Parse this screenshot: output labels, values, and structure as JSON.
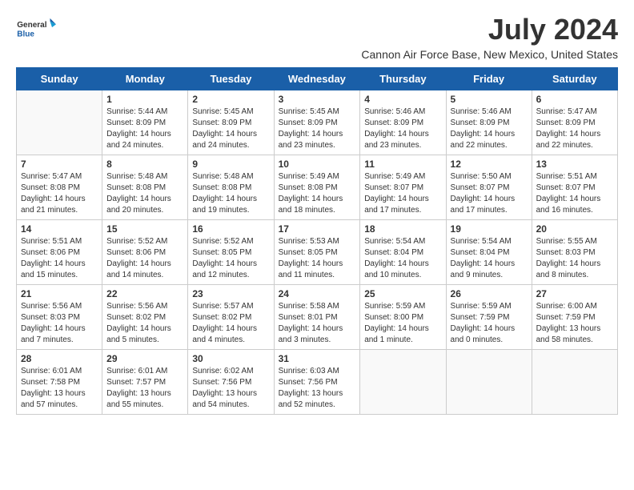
{
  "header": {
    "logo_general": "General",
    "logo_blue": "Blue",
    "month": "July 2024",
    "location": "Cannon Air Force Base, New Mexico, United States"
  },
  "weekdays": [
    "Sunday",
    "Monday",
    "Tuesday",
    "Wednesday",
    "Thursday",
    "Friday",
    "Saturday"
  ],
  "weeks": [
    [
      {
        "day": "",
        "info": ""
      },
      {
        "day": "1",
        "info": "Sunrise: 5:44 AM\nSunset: 8:09 PM\nDaylight: 14 hours\nand 24 minutes."
      },
      {
        "day": "2",
        "info": "Sunrise: 5:45 AM\nSunset: 8:09 PM\nDaylight: 14 hours\nand 24 minutes."
      },
      {
        "day": "3",
        "info": "Sunrise: 5:45 AM\nSunset: 8:09 PM\nDaylight: 14 hours\nand 23 minutes."
      },
      {
        "day": "4",
        "info": "Sunrise: 5:46 AM\nSunset: 8:09 PM\nDaylight: 14 hours\nand 23 minutes."
      },
      {
        "day": "5",
        "info": "Sunrise: 5:46 AM\nSunset: 8:09 PM\nDaylight: 14 hours\nand 22 minutes."
      },
      {
        "day": "6",
        "info": "Sunrise: 5:47 AM\nSunset: 8:09 PM\nDaylight: 14 hours\nand 22 minutes."
      }
    ],
    [
      {
        "day": "7",
        "info": "Sunrise: 5:47 AM\nSunset: 8:08 PM\nDaylight: 14 hours\nand 21 minutes."
      },
      {
        "day": "8",
        "info": "Sunrise: 5:48 AM\nSunset: 8:08 PM\nDaylight: 14 hours\nand 20 minutes."
      },
      {
        "day": "9",
        "info": "Sunrise: 5:48 AM\nSunset: 8:08 PM\nDaylight: 14 hours\nand 19 minutes."
      },
      {
        "day": "10",
        "info": "Sunrise: 5:49 AM\nSunset: 8:08 PM\nDaylight: 14 hours\nand 18 minutes."
      },
      {
        "day": "11",
        "info": "Sunrise: 5:49 AM\nSunset: 8:07 PM\nDaylight: 14 hours\nand 17 minutes."
      },
      {
        "day": "12",
        "info": "Sunrise: 5:50 AM\nSunset: 8:07 PM\nDaylight: 14 hours\nand 17 minutes."
      },
      {
        "day": "13",
        "info": "Sunrise: 5:51 AM\nSunset: 8:07 PM\nDaylight: 14 hours\nand 16 minutes."
      }
    ],
    [
      {
        "day": "14",
        "info": "Sunrise: 5:51 AM\nSunset: 8:06 PM\nDaylight: 14 hours\nand 15 minutes."
      },
      {
        "day": "15",
        "info": "Sunrise: 5:52 AM\nSunset: 8:06 PM\nDaylight: 14 hours\nand 14 minutes."
      },
      {
        "day": "16",
        "info": "Sunrise: 5:52 AM\nSunset: 8:05 PM\nDaylight: 14 hours\nand 12 minutes."
      },
      {
        "day": "17",
        "info": "Sunrise: 5:53 AM\nSunset: 8:05 PM\nDaylight: 14 hours\nand 11 minutes."
      },
      {
        "day": "18",
        "info": "Sunrise: 5:54 AM\nSunset: 8:04 PM\nDaylight: 14 hours\nand 10 minutes."
      },
      {
        "day": "19",
        "info": "Sunrise: 5:54 AM\nSunset: 8:04 PM\nDaylight: 14 hours\nand 9 minutes."
      },
      {
        "day": "20",
        "info": "Sunrise: 5:55 AM\nSunset: 8:03 PM\nDaylight: 14 hours\nand 8 minutes."
      }
    ],
    [
      {
        "day": "21",
        "info": "Sunrise: 5:56 AM\nSunset: 8:03 PM\nDaylight: 14 hours\nand 7 minutes."
      },
      {
        "day": "22",
        "info": "Sunrise: 5:56 AM\nSunset: 8:02 PM\nDaylight: 14 hours\nand 5 minutes."
      },
      {
        "day": "23",
        "info": "Sunrise: 5:57 AM\nSunset: 8:02 PM\nDaylight: 14 hours\nand 4 minutes."
      },
      {
        "day": "24",
        "info": "Sunrise: 5:58 AM\nSunset: 8:01 PM\nDaylight: 14 hours\nand 3 minutes."
      },
      {
        "day": "25",
        "info": "Sunrise: 5:59 AM\nSunset: 8:00 PM\nDaylight: 14 hours\nand 1 minute."
      },
      {
        "day": "26",
        "info": "Sunrise: 5:59 AM\nSunset: 7:59 PM\nDaylight: 14 hours\nand 0 minutes."
      },
      {
        "day": "27",
        "info": "Sunrise: 6:00 AM\nSunset: 7:59 PM\nDaylight: 13 hours\nand 58 minutes."
      }
    ],
    [
      {
        "day": "28",
        "info": "Sunrise: 6:01 AM\nSunset: 7:58 PM\nDaylight: 13 hours\nand 57 minutes."
      },
      {
        "day": "29",
        "info": "Sunrise: 6:01 AM\nSunset: 7:57 PM\nDaylight: 13 hours\nand 55 minutes."
      },
      {
        "day": "30",
        "info": "Sunrise: 6:02 AM\nSunset: 7:56 PM\nDaylight: 13 hours\nand 54 minutes."
      },
      {
        "day": "31",
        "info": "Sunrise: 6:03 AM\nSunset: 7:56 PM\nDaylight: 13 hours\nand 52 minutes."
      },
      {
        "day": "",
        "info": ""
      },
      {
        "day": "",
        "info": ""
      },
      {
        "day": "",
        "info": ""
      }
    ]
  ]
}
